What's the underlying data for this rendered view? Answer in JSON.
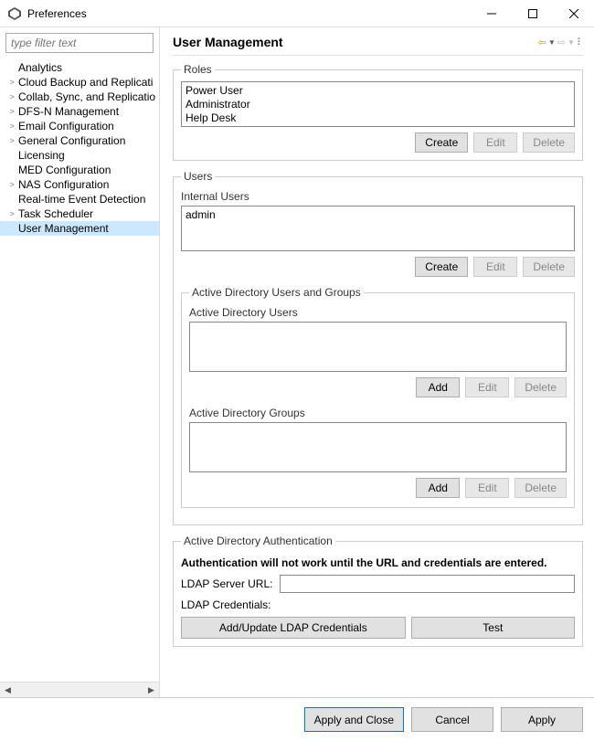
{
  "window": {
    "title": "Preferences"
  },
  "filter": {
    "placeholder": "type filter text"
  },
  "tree": {
    "items": [
      {
        "label": "Analytics",
        "expandable": false
      },
      {
        "label": "Cloud Backup and Replicati",
        "expandable": true
      },
      {
        "label": "Collab, Sync, and Replicatio",
        "expandable": true
      },
      {
        "label": "DFS-N Management",
        "expandable": true
      },
      {
        "label": "Email Configuration",
        "expandable": true
      },
      {
        "label": "General Configuration",
        "expandable": true
      },
      {
        "label": "Licensing",
        "expandable": false
      },
      {
        "label": "MED Configuration",
        "expandable": false
      },
      {
        "label": "NAS Configuration",
        "expandable": true
      },
      {
        "label": "Real-time Event Detection",
        "expandable": false
      },
      {
        "label": "Task Scheduler",
        "expandable": true
      },
      {
        "label": "User Management",
        "expandable": false,
        "selected": true
      }
    ]
  },
  "page": {
    "title": "User Management",
    "roles": {
      "legend": "Roles",
      "items": [
        "Power User",
        "Administrator",
        "Help Desk"
      ],
      "btn_create": "Create",
      "btn_edit": "Edit",
      "btn_delete": "Delete"
    },
    "users": {
      "legend": "Users",
      "internal": {
        "label": "Internal Users",
        "items": [
          "admin"
        ],
        "btn_create": "Create",
        "btn_edit": "Edit",
        "btn_delete": "Delete"
      },
      "ad": {
        "legend": "Active Directory Users and Groups",
        "users": {
          "label": "Active Directory Users",
          "items": [],
          "btn_add": "Add",
          "btn_edit": "Edit",
          "btn_delete": "Delete"
        },
        "groups": {
          "label": "Active Directory Groups",
          "items": [],
          "btn_add": "Add",
          "btn_edit": "Edit",
          "btn_delete": "Delete"
        }
      }
    },
    "auth": {
      "legend": "Active Directory Authentication",
      "warning": "Authentication will not work until the URL and credentials are entered.",
      "url_label": "LDAP Server URL:",
      "url_value": "",
      "cred_label": "LDAP Credentials:",
      "btn_add_update": "Add/Update LDAP Credentials",
      "btn_test": "Test"
    }
  },
  "footer": {
    "apply_close": "Apply and Close",
    "cancel": "Cancel",
    "apply": "Apply"
  }
}
